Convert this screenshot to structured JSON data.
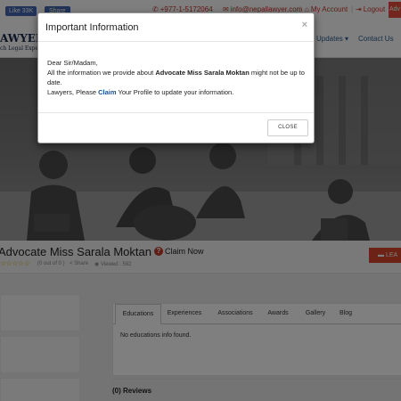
{
  "topbar": {
    "like_label": "Like 33K",
    "share_label": "Share",
    "phone": "+977-1-5172064",
    "email": "info@nepallawyer.com",
    "my_account": "My Account",
    "logout": "Logout",
    "corner_text": "Adv"
  },
  "header": {
    "logo": "AWYER",
    "tagline": "ch Legal Experts",
    "nav": [
      "Updates",
      "Contact Us"
    ]
  },
  "profile": {
    "name": "Advocate Miss Sarala Moktan",
    "claim_icon": "?",
    "claim_label": "Claim Now",
    "stars": "☆☆☆☆☆",
    "rating_text": "(0 out of 0 )",
    "share_text": "Share",
    "viewed_text": "Viewed : 592",
    "leave_button": "LEA"
  },
  "tabs": {
    "items": [
      "Educations",
      "Experiences",
      "Associations",
      "Awards",
      "Gallery",
      "Blog"
    ],
    "active": "Educations",
    "empty_message": "No educations info found."
  },
  "reviews": {
    "label": "(0) Reviews"
  },
  "modal": {
    "title": "Important Information",
    "close_x": "×",
    "greeting": "Dear Sir/Madam,",
    "line1_prefix": "All the information we provide about ",
    "line1_name": "Advocate Miss Sarala Moktan",
    "line1_suffix": " might not be up to date.",
    "line2_prefix": "Lawyers, Please ",
    "line2_link": "Claim",
    "line2_suffix": " Your Profile to update your information.",
    "close_button": "CLOSE"
  },
  "icons": {
    "phone": "phone-icon",
    "email": "email-icon",
    "account": "user-icon",
    "logout": "logout-icon",
    "share": "share-icon",
    "viewed": "eye-icon",
    "comment": "comment-icon"
  },
  "colors": {
    "accent_red": "#c0392b",
    "link_blue": "#1f4e8c",
    "facebook_blue": "#4267b2",
    "leave_button": "#d9472b"
  }
}
